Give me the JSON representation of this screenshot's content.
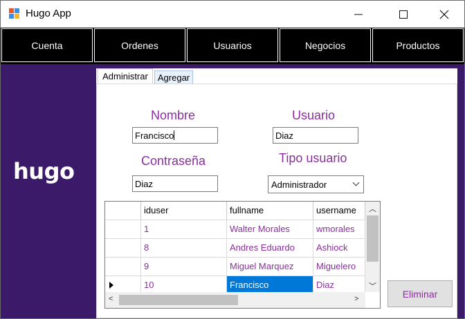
{
  "window": {
    "title": "Hugo App",
    "minimize": "—",
    "maximize": "☐",
    "close": "✕"
  },
  "nav": {
    "items": [
      "Cuenta",
      "Ordenes",
      "Usuarios",
      "Negocios",
      "Productos"
    ]
  },
  "sidebar": {
    "logo": "hugo"
  },
  "tabs": [
    {
      "label": "Administrar",
      "active": true
    },
    {
      "label": "Agregar",
      "active": false
    }
  ],
  "form": {
    "nombre_label": "Nombre",
    "nombre_value": "Francisco",
    "usuario_label": "Usuario",
    "usuario_value": "Diaz",
    "contrasena_label": "Contraseña",
    "contrasena_value": "Diaz",
    "tipo_label": "Tipo usuario",
    "tipo_value": "Administrador"
  },
  "table": {
    "columns": [
      "iduser",
      "fullname",
      "username"
    ],
    "rows": [
      {
        "iduser": "1",
        "fullname": "Walter Morales",
        "username": "wmorales"
      },
      {
        "iduser": "8",
        "fullname": "Andres Eduardo",
        "username": "Ashiock"
      },
      {
        "iduser": "9",
        "fullname": "Miguel Marquez",
        "username": "Miguelero"
      },
      {
        "iduser": "10",
        "fullname": "Francisco",
        "username": "Diaz"
      }
    ],
    "current_row": 3,
    "selected_cell": "fullname"
  },
  "actions": {
    "delete_label": "Eliminar"
  },
  "colors": {
    "accent_purple": "#8a2e9e",
    "sidebar_bg": "#3b1a6a",
    "nav_bg": "#000000",
    "selection": "#0078d7"
  }
}
